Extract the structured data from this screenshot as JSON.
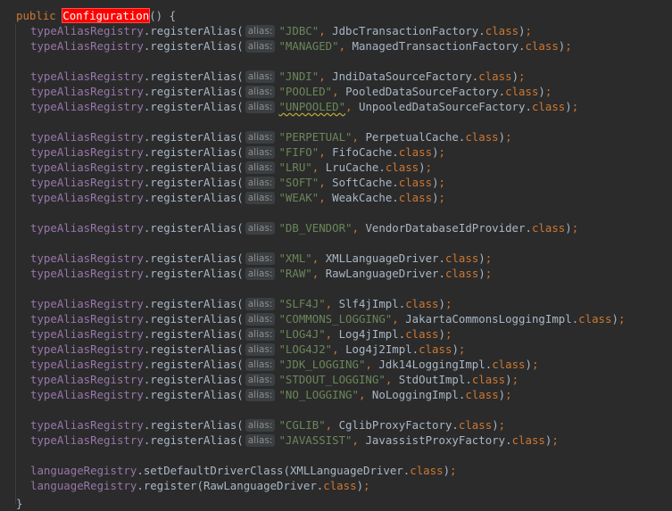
{
  "editor": {
    "header": {
      "modifier": "public",
      "method_name": "Configuration",
      "suffix": "() {"
    },
    "alias_hint": "alias:",
    "registry_object": "typeAliasRegistry",
    "register_method": "registerAlias",
    "class_keyword": "class",
    "alias_lines": [
      {
        "alias": "\"JDBC\"",
        "cls": "JdbcTransactionFactory"
      },
      {
        "alias": "\"MANAGED\"",
        "cls": "ManagedTransactionFactory"
      },
      {
        "alias": "\"JNDI\"",
        "cls": "JndiDataSourceFactory"
      },
      {
        "alias": "\"POOLED\"",
        "cls": "PooledDataSourceFactory"
      },
      {
        "alias": "\"UNPOOLED\"",
        "cls": "UnpooledDataSourceFactory",
        "warning": true
      },
      {
        "alias": "\"PERPETUAL\"",
        "cls": "PerpetualCache"
      },
      {
        "alias": "\"FIFO\"",
        "cls": "FifoCache"
      },
      {
        "alias": "\"LRU\"",
        "cls": "LruCache"
      },
      {
        "alias": "\"SOFT\"",
        "cls": "SoftCache"
      },
      {
        "alias": "\"WEAK\"",
        "cls": "WeakCache"
      },
      {
        "alias": "\"DB_VENDOR\"",
        "cls": "VendorDatabaseIdProvider"
      },
      {
        "alias": "\"XML\"",
        "cls": "XMLLanguageDriver"
      },
      {
        "alias": "\"RAW\"",
        "cls": "RawLanguageDriver"
      },
      {
        "alias": "\"SLF4J\"",
        "cls": "Slf4jImpl"
      },
      {
        "alias": "\"COMMONS_LOGGING\"",
        "cls": "JakartaCommonsLoggingImpl"
      },
      {
        "alias": "\"LOG4J\"",
        "cls": "Log4jImpl"
      },
      {
        "alias": "\"LOG4J2\"",
        "cls": "Log4j2Impl"
      },
      {
        "alias": "\"JDK_LOGGING\"",
        "cls": "Jdk14LoggingImpl"
      },
      {
        "alias": "\"STDOUT_LOGGING\"",
        "cls": "StdOutImpl"
      },
      {
        "alias": "\"NO_LOGGING\"",
        "cls": "NoLoggingImpl"
      },
      {
        "alias": "\"CGLIB\"",
        "cls": "CglibProxyFactory"
      },
      {
        "alias": "\"JAVASSIST\"",
        "cls": "JavassistProxyFactory"
      }
    ],
    "language_lines": [
      {
        "object": "languageRegistry",
        "method": "setDefaultDriverClass",
        "arg": "XMLLanguageDriver"
      },
      {
        "object": "languageRegistry",
        "method": "register",
        "arg": "RawLanguageDriver"
      }
    ],
    "closing_brace": "}",
    "colors": {
      "background": "#2b2b2b",
      "keyword": "#cc7832",
      "field": "#9876aa",
      "string": "#6a8759",
      "plain": "#a9b7c6",
      "highlight": "#ff0000",
      "hint_bg": "#3b3f41"
    }
  }
}
